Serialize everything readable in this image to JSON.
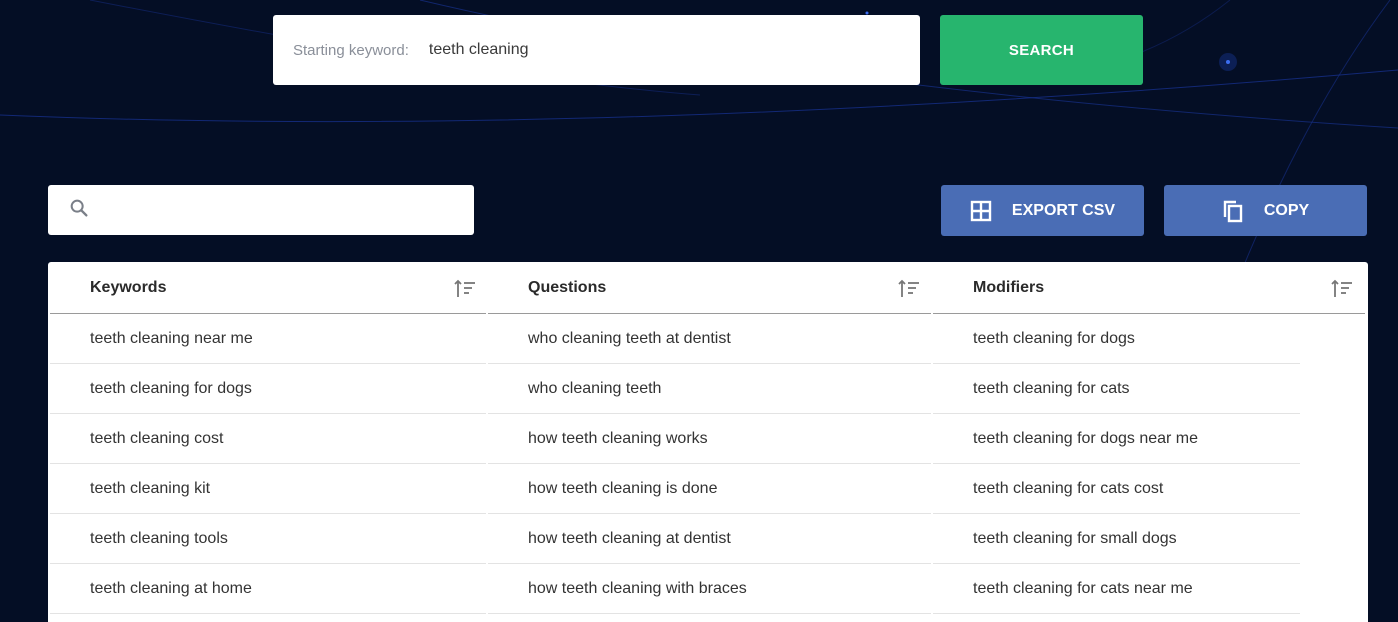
{
  "search": {
    "label": "Starting keyword:",
    "value": "teeth cleaning",
    "button_label": "SEARCH"
  },
  "filter": {
    "placeholder": ""
  },
  "actions": {
    "export_label": "EXPORT CSV",
    "copy_label": "COPY"
  },
  "table": {
    "columns": [
      {
        "title": "Keywords",
        "rows": [
          "teeth cleaning near me",
          "teeth cleaning for dogs",
          "teeth cleaning cost",
          "teeth cleaning kit",
          "teeth cleaning tools",
          "teeth cleaning at home"
        ]
      },
      {
        "title": "Questions",
        "rows": [
          "who cleaning teeth at dentist",
          "who cleaning teeth",
          "how teeth cleaning works",
          "how teeth cleaning is done",
          "how teeth cleaning at dentist",
          "how teeth cleaning with braces"
        ]
      },
      {
        "title": "Modifiers",
        "rows": [
          "teeth cleaning for dogs",
          "teeth cleaning for cats",
          "teeth cleaning for dogs near me",
          "teeth cleaning for cats cost",
          "teeth cleaning for small dogs",
          "teeth cleaning for cats near me"
        ]
      }
    ]
  },
  "colors": {
    "background": "#040e25",
    "search_button": "#27b56e",
    "action_button": "#4a6db5"
  },
  "icons": {
    "filter": "search-icon",
    "export": "grid-icon",
    "copy": "copy-icon",
    "sort": "sort-icon"
  }
}
